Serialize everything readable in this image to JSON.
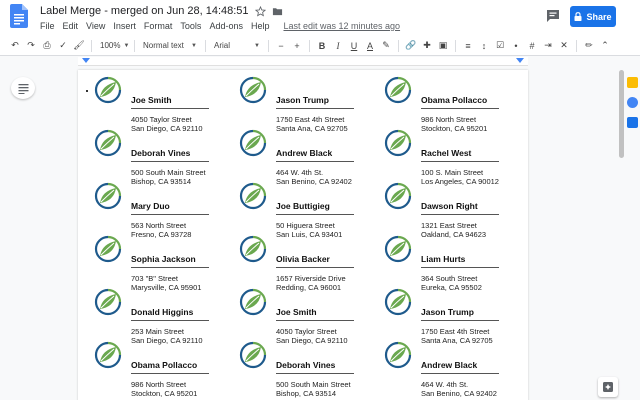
{
  "app": {
    "title": "Label Merge - merged on Jun 28, 14:48:51",
    "menu": [
      "File",
      "Edit",
      "View",
      "Insert",
      "Format",
      "Tools",
      "Add-ons",
      "Help"
    ],
    "last_edit": "Last edit was 12 minutes ago",
    "share_label": "Share"
  },
  "toolbar": {
    "zoom": "100%",
    "style": "Normal text",
    "font": "Arial",
    "bold": "B",
    "italic": "I",
    "underline": "U",
    "text_color": "A"
  },
  "colors": {
    "accent": "#1a73e8",
    "leaf_green": "#6aa84f",
    "leaf_dark": "#2e7d32",
    "ring_blue": "#1e5a8c"
  },
  "labels": [
    {
      "name": "Joe Smith",
      "street": "4050 Taylor Street",
      "city": "San Diego, CA 92110"
    },
    {
      "name": "Jason Trump",
      "street": "1750 East 4th Street",
      "city": "Santa Ana, CA 92705"
    },
    {
      "name": "Obama Pollacco",
      "street": "986 North Street",
      "city": "Stockton, CA 95201"
    },
    {
      "name": "Deborah Vines",
      "street": "500 South Main Street",
      "city": "Bishop, CA 93514"
    },
    {
      "name": "Andrew Black",
      "street": "464 W. 4th St.",
      "city": "San Benino, CA 92402"
    },
    {
      "name": "Rachel West",
      "street": "100 S. Main Street",
      "city": "Los Angeles, CA 90012"
    },
    {
      "name": "Mary Duo",
      "street": "563 North Street",
      "city": "Fresno, CA 93728"
    },
    {
      "name": "Joe Buttigieg",
      "street": "50 Higuera Street",
      "city": "San Luis, CA 93401"
    },
    {
      "name": "Dawson Right",
      "street": "1321 East Street",
      "city": "Oakland, CA 94623"
    },
    {
      "name": "Sophia Jackson",
      "street": "703 \"B\" Street",
      "city": "Marysville, CA 95901"
    },
    {
      "name": "Olivia Backer",
      "street": "1657 Riverside Drive",
      "city": "Redding, CA 96001"
    },
    {
      "name": "Liam Hurts",
      "street": "364 South Street",
      "city": "Eureka, CA 95502"
    },
    {
      "name": "Donald Higgins",
      "street": "253 Main Street",
      "city": "San Diego, CA 92110"
    },
    {
      "name": "Joe Smith",
      "street": "4050 Taylor Street",
      "city": "San Diego, CA 92110"
    },
    {
      "name": "Jason Trump",
      "street": "1750 East 4th Street",
      "city": "Santa Ana, CA 92705"
    },
    {
      "name": "Obama Pollacco",
      "street": "986 North Street",
      "city": "Stockton, CA 95201"
    },
    {
      "name": "Deborah Vines",
      "street": "500 South Main Street",
      "city": "Bishop, CA 93514"
    },
    {
      "name": "Andrew Black",
      "street": "464 W. 4th St.",
      "city": "San Benino, CA 92402"
    }
  ]
}
